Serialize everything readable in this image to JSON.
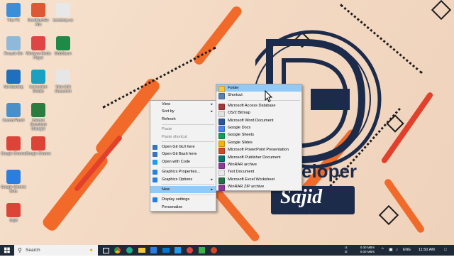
{
  "desktop_icons": [
    {
      "label": "This PC",
      "color": "#3a8fd8"
    },
    {
      "label": "Recycle Bin",
      "color": "#8fb9d9"
    },
    {
      "label": "Net Banking",
      "color": "#1f6fbf"
    },
    {
      "label": "Control Panel",
      "color": "#4a90c8"
    },
    {
      "label": "Google Chrome",
      "color": "#db4437"
    },
    {
      "label": "Google Chrome Beta",
      "color": "#2a7de1"
    },
    {
      "label": "Sajid",
      "color": "#db4437"
    },
    {
      "label": "DuckDuckGo Ads",
      "color": "#de5833"
    },
    {
      "label": "Windows Media Player",
      "color": "#e04545"
    },
    {
      "label": "Connection Details",
      "color": "#1aa0c0"
    },
    {
      "label": "Internet Download Manager",
      "color": "#2a7d3f"
    },
    {
      "label": "Google Chrome",
      "color": "#db4437"
    },
    {
      "label": "bootstrap.rar",
      "color": "#e8e8e8"
    },
    {
      "label": "MobiSaver",
      "color": "#1e8a48"
    },
    {
      "label": "View Unit Document",
      "color": "#e6e6e6"
    }
  ],
  "context_menu": {
    "items": [
      {
        "label": "View",
        "submenu": true,
        "disabled": false
      },
      {
        "label": "Sort by",
        "submenu": true,
        "disabled": false
      },
      {
        "label": "Refresh",
        "submenu": false,
        "disabled": false
      },
      {
        "label": "Paste",
        "submenu": false,
        "disabled": true
      },
      {
        "label": "Paste shortcut",
        "submenu": false,
        "disabled": true
      },
      {
        "label": "Open Git GUI here",
        "submenu": false,
        "disabled": false
      },
      {
        "label": "Open Git Bash here",
        "submenu": false,
        "disabled": false
      },
      {
        "label": "Open with Code",
        "submenu": false,
        "disabled": false
      },
      {
        "label": "Graphics Properties...",
        "submenu": false,
        "disabled": false
      },
      {
        "label": "Graphics Options",
        "submenu": true,
        "disabled": false
      },
      {
        "label": "New",
        "submenu": true,
        "disabled": false,
        "highlighted": true
      },
      {
        "label": "Display settings",
        "submenu": false,
        "disabled": false
      },
      {
        "label": "Personalize",
        "submenu": false,
        "disabled": false
      }
    ]
  },
  "new_submenu": {
    "items": [
      {
        "label": "Folder",
        "icon": "folder-icon",
        "color": "#f5c842"
      },
      {
        "label": "Shortcut",
        "icon": "shortcut-icon",
        "color": "#5a7fb0"
      },
      {
        "label": "Microsoft Access Database",
        "icon": "access-icon",
        "color": "#a4373a"
      },
      {
        "label": "OS/2 Bitmap",
        "icon": "bitmap-icon",
        "color": "#e0e0e0"
      },
      {
        "label": "Microsoft Word Document",
        "icon": "word-icon",
        "color": "#2b579a"
      },
      {
        "label": "Google Docs",
        "icon": "google-docs-icon",
        "color": "#4285f4"
      },
      {
        "label": "Google Sheets",
        "icon": "google-sheets-icon",
        "color": "#0f9d58"
      },
      {
        "label": "Google Slides",
        "icon": "google-slides-icon",
        "color": "#f4b400"
      },
      {
        "label": "Microsoft PowerPoint Presentation",
        "icon": "powerpoint-icon",
        "color": "#d24726"
      },
      {
        "label": "Microsoft Publisher Document",
        "icon": "publisher-icon",
        "color": "#077568"
      },
      {
        "label": "WinRAR archive",
        "icon": "winrar-icon",
        "color": "#8b3a9c"
      },
      {
        "label": "Text Document",
        "icon": "text-document-icon",
        "color": "#e8e8e8"
      },
      {
        "label": "Microsoft Excel Worksheet",
        "icon": "excel-icon",
        "color": "#217346"
      },
      {
        "label": "WinRAR ZIP archive",
        "icon": "winrar-zip-icon",
        "color": "#8b3a9c"
      }
    ]
  },
  "wallpaper": {
    "brand_text": "eloper",
    "signature": "Sajid"
  },
  "taskbar": {
    "search_placeholder": "Search",
    "net_up": "0.00 MB/s",
    "net_down": "0.00 MB/s",
    "net_up_label": "U:",
    "net_down_label": "D:",
    "language": "ENG",
    "time": "11:50 AM"
  },
  "colors": {
    "accent": "#0078d4",
    "menu_highlight": "#91c9f7",
    "taskbar": "#1e2a38",
    "stripe": "#f15a24"
  }
}
